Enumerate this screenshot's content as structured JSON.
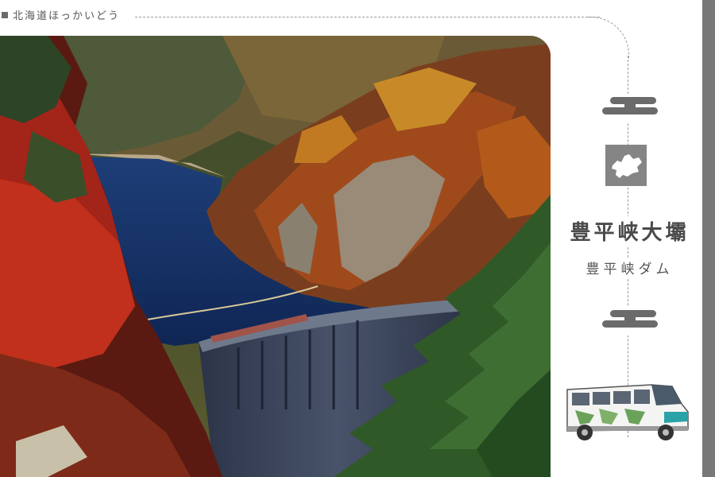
{
  "header": {
    "label": "北海道ほっかいどう"
  },
  "title": {
    "main": "豊平峡大壩",
    "sub": "豊平峡ダム"
  },
  "icons": {
    "map": "hokkaido-map-icon",
    "bus": "bus-illustration",
    "deco": "cloud-ornament-icon"
  },
  "colors": {
    "accent_gray": "#787878",
    "map_gray": "#858585",
    "text": "#4a4a4a"
  }
}
